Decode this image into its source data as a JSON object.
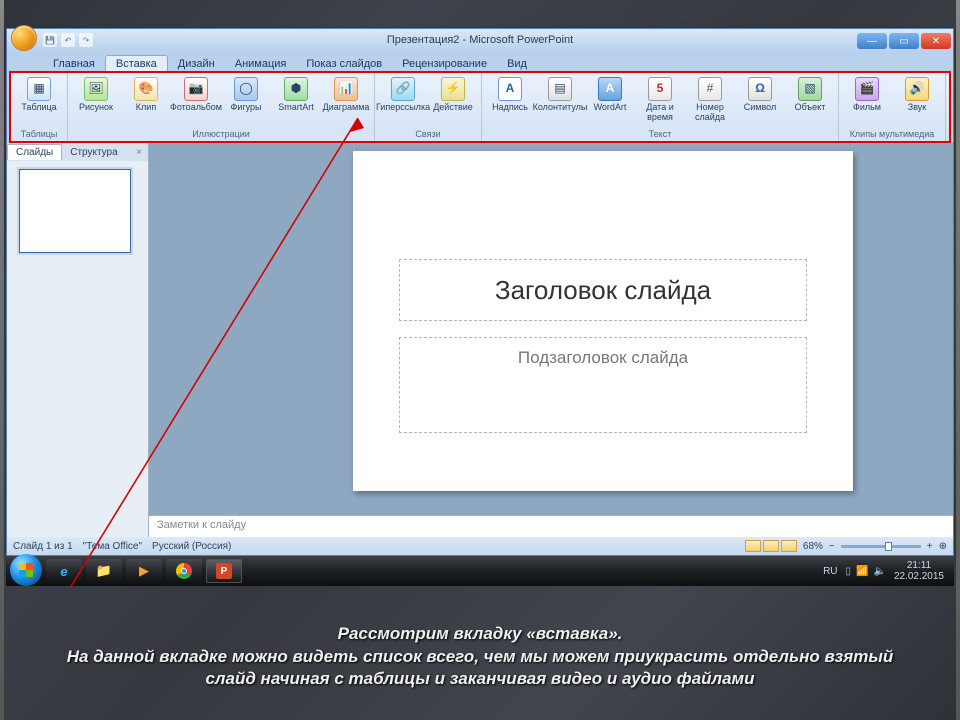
{
  "title": "Презентация2 - Microsoft PowerPoint",
  "qat": {
    "save": "💾",
    "undo": "↶",
    "redo": "↷"
  },
  "win": {
    "min": "—",
    "max": "▭",
    "close": "✕"
  },
  "tabs": {
    "home": "Главная",
    "insert": "Вставка",
    "design": "Дизайн",
    "anim": "Анимация",
    "show": "Показ слайдов",
    "review": "Рецензирование",
    "view": "Вид"
  },
  "ribbon": {
    "tables": {
      "label": "Таблицы",
      "table": "Таблица"
    },
    "illus": {
      "label": "Иллюстрации",
      "picture": "Рисунок",
      "clip": "Клип",
      "album": "Фотоальбом",
      "shapes": "Фигуры",
      "smartart": "SmartArt",
      "chart": "Диаграмма"
    },
    "links": {
      "label": "Связи",
      "hyperlink": "Гиперссылка",
      "action": "Действие"
    },
    "text": {
      "label": "Текст",
      "textbox": "Надпись",
      "headerfooter": "Колонтитулы",
      "wordart": "WordArt",
      "datetime": "Дата и время",
      "slidenum": "Номер слайда",
      "symbol": "Символ",
      "object": "Объект"
    },
    "media": {
      "label": "Клипы мультимедиа",
      "movie": "Фильм",
      "sound": "Звук"
    }
  },
  "icons": {
    "table": "▦",
    "picture": "🖼",
    "clip": "🎨",
    "album": "📷",
    "shapes": "◯",
    "smartart": "⬢",
    "chart": "📊",
    "hyperlink": "🔗",
    "action": "⚡",
    "textbox": "A",
    "headerfooter": "▤",
    "wordart": "A",
    "datetime": "5",
    "slidenum": "#",
    "symbol": "Ω",
    "object": "▧",
    "movie": "🎬",
    "sound": "🔊"
  },
  "sidepanel": {
    "slides": "Слайды",
    "outline": "Структура",
    "close": "×"
  },
  "slide": {
    "title": "Заголовок слайда",
    "subtitle": "Подзаголовок слайда"
  },
  "notes": "Заметки к слайду",
  "status": {
    "slide": "Слайд 1 из 1",
    "theme": "\"Тема Office\"",
    "lang": "Русский (Россия)",
    "zoom": "68%",
    "fit": "⊕"
  },
  "taskbar": {
    "ie": "e",
    "explorer": "📁",
    "wmp": "▶",
    "chrome": "◯",
    "ppt": "P",
    "tray_lang": "RU",
    "tray_flag": "▯",
    "tray_net": "📶",
    "tray_vol": "🔈",
    "time": "21:11",
    "date": "22.02.2015"
  },
  "caption": {
    "l1": "Рассмотрим вкладку «вставка».",
    "l2": "На данной вкладке можно видеть список всего, чем мы можем приукрасить отдельно взятый слайд начиная с таблицы и заканчивая видео и аудио файлами"
  }
}
